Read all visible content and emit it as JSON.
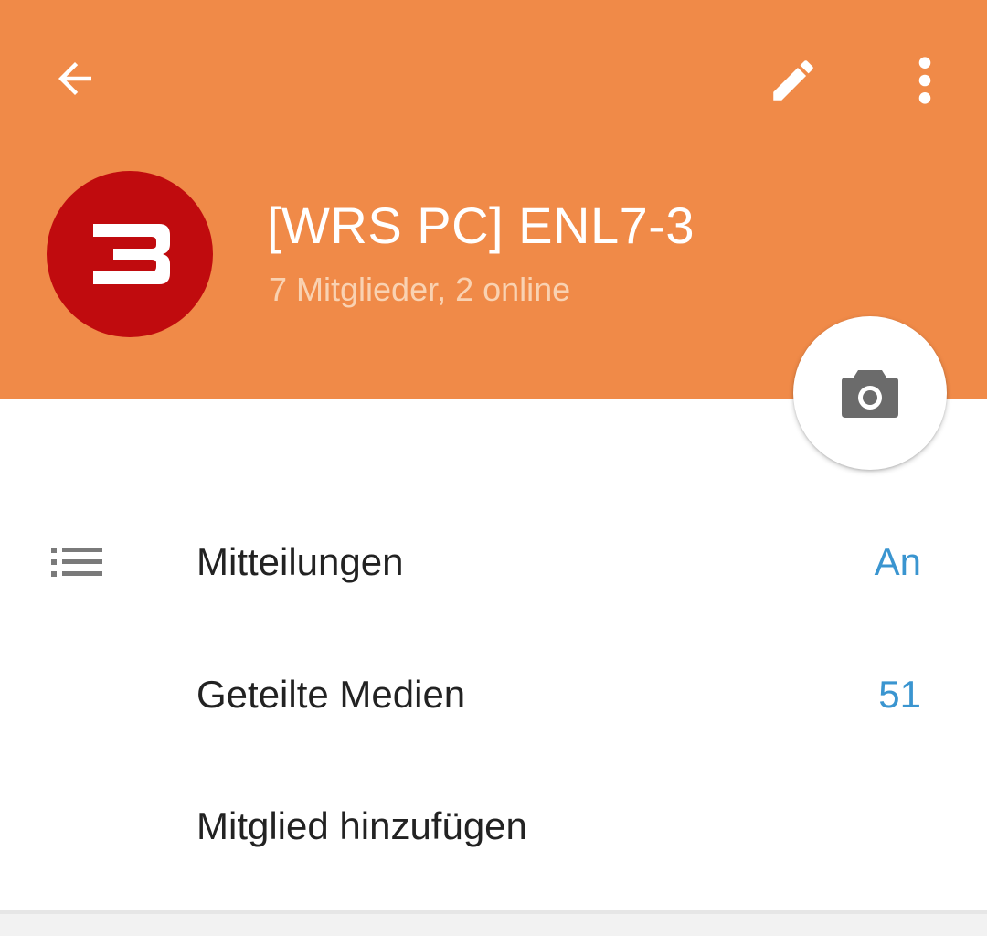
{
  "header": {
    "background_color": "#f08a48",
    "back_icon": "arrow-left-icon",
    "edit_icon": "pencil-icon",
    "more_icon": "more-vertical-icon"
  },
  "group": {
    "avatar_text": "3",
    "avatar_color": "#c00b0e",
    "title": "[WRS PC] ENL7-3",
    "subtitle": "7 Mitglieder, 2 online"
  },
  "fab": {
    "icon": "camera-icon"
  },
  "settings": {
    "notifications": {
      "icon": "list-icon",
      "label": "Mitteilungen",
      "value": "An"
    },
    "shared_media": {
      "label": "Geteilte Medien",
      "value": "51"
    },
    "add_member": {
      "label": "Mitglied hinzufügen"
    },
    "value_color": "#3a95d0"
  }
}
